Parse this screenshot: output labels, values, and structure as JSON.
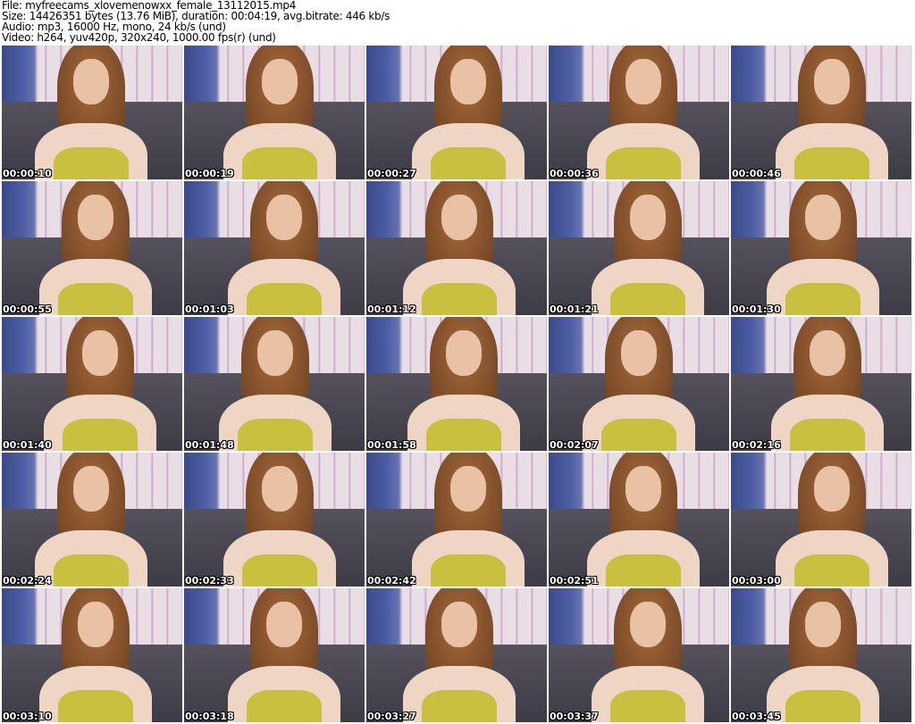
{
  "header": {
    "file": "File: myfreecams_xlovemenowxx_female_13112015.mp4",
    "size": "Size: 14426351 bytes (13.76 MiB), duration: 00:04:19, avg.bitrate: 446 kb/s",
    "audio": "Audio: mp3, 16000 Hz, mono, 24 kb/s (und)",
    "video": "Video: h264, yuv420p, 320x240, 1000.00 fps(r) (und)"
  },
  "thumbnails": [
    "00:00:10",
    "00:00:19",
    "00:00:27",
    "00:00:36",
    "00:00:46",
    "00:00:55",
    "00:01:03",
    "00:01:12",
    "00:01:21",
    "00:01:30",
    "00:01:40",
    "00:01:48",
    "00:01:58",
    "00:02:07",
    "00:02:16",
    "00:02:24",
    "00:02:33",
    "00:02:42",
    "00:02:51",
    "00:03:00",
    "00:03:10",
    "00:03:18",
    "00:03:27",
    "00:03:37",
    "00:03:45"
  ]
}
